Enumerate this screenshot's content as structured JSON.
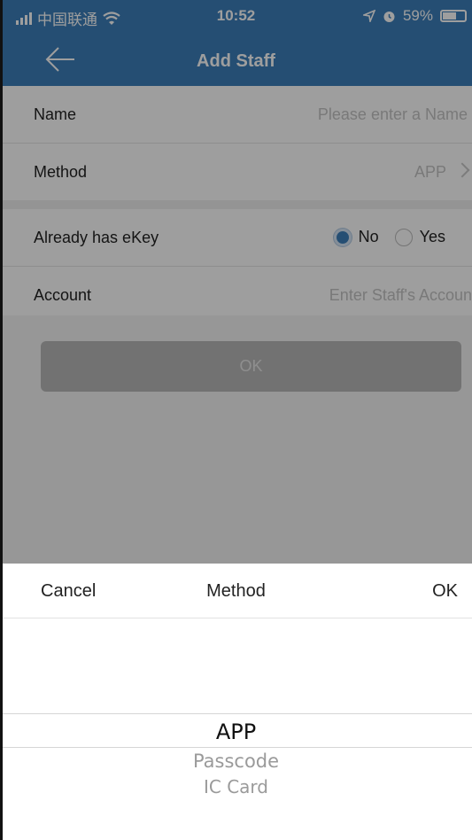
{
  "status_bar": {
    "carrier": "中国联通",
    "time": "10:52",
    "battery": "59%",
    "battery_level": 0.59
  },
  "nav": {
    "title": "Add Staff"
  },
  "form": {
    "name": {
      "label": "Name",
      "placeholder": "Please enter a Name"
    },
    "method": {
      "label": "Method",
      "value": "APP"
    },
    "ekey": {
      "label": "Already has eKey",
      "options": [
        "No",
        "Yes"
      ],
      "selected": "No"
    },
    "account": {
      "label": "Account",
      "placeholder": "Enter Staff's Accoun"
    },
    "ok_label": "OK"
  },
  "picker": {
    "cancel_label": "Cancel",
    "title": "Method",
    "ok_label": "OK",
    "options": [
      "APP",
      "Passcode",
      "IC Card"
    ],
    "selected": "APP"
  },
  "colors": {
    "accent": "#3d7fba"
  }
}
